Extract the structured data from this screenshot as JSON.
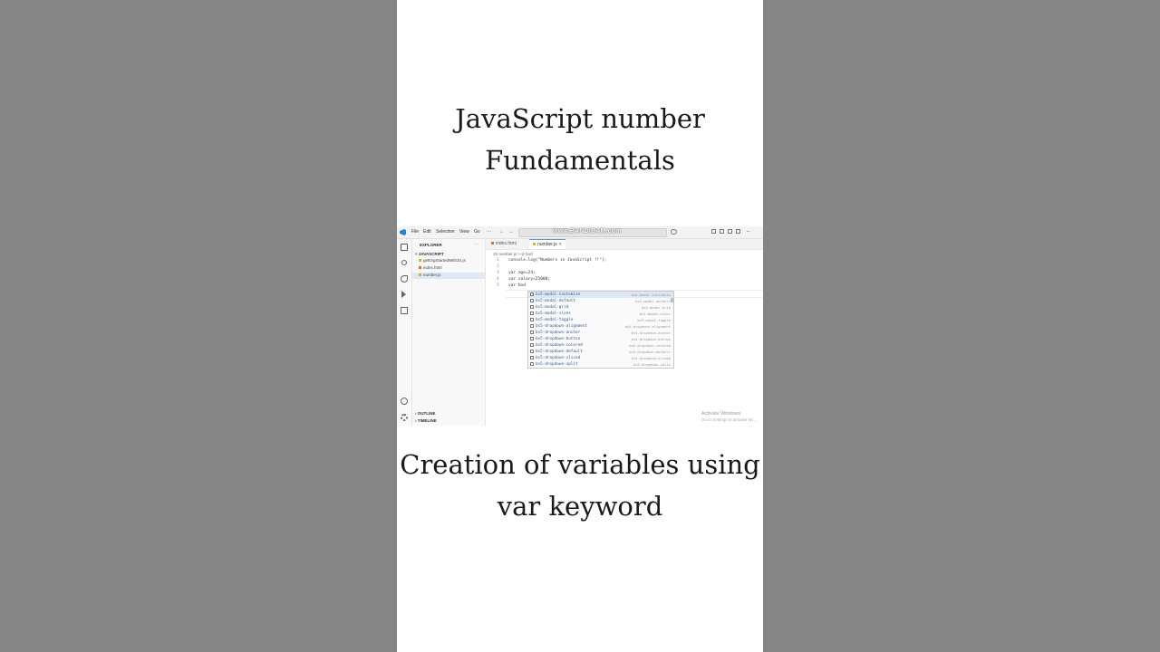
{
  "heading": {
    "line1": "JavaScript number",
    "line2": "Fundamentals"
  },
  "caption": {
    "line1": "Creation of variables using",
    "line2": "var keyword"
  },
  "menubar": {
    "items": [
      "File",
      "Edit",
      "Selection",
      "View",
      "Go",
      "···"
    ],
    "back_arrow": "←",
    "forward_arrow": "→",
    "watermark": "www.BANDICAM.com"
  },
  "sidebar": {
    "title": "EXPLORER",
    "more": "···",
    "folder": "JAVASCRIPT",
    "files": [
      "gettingStartedWithJS.js",
      "index.html",
      "number.js"
    ],
    "outline": "OUTLINE",
    "timeline": "TIMELINE"
  },
  "tabs": [
    {
      "label": "index.html",
      "active": false
    },
    {
      "label": "number.js",
      "active": true,
      "close": "✕"
    }
  ],
  "breadcrumb": "JS number.js > ⊘ bod",
  "code": {
    "line_numbers": [
      "1",
      "2",
      "3",
      "4",
      "5"
    ],
    "lines": [
      "console.log(\"Numbers in JavaScript !!\");",
      "",
      "var age=24;",
      "var salary=25000;",
      "var bod"
    ]
  },
  "suggestions": [
    {
      "name": "bs5-modal-customize",
      "detail": "bs5-modal-customize",
      "selected": true
    },
    {
      "name": "bs5-modal-default",
      "detail": "bs5-modal-default"
    },
    {
      "name": "bs5-modal-grid",
      "detail": "bs5-modal-grid"
    },
    {
      "name": "bs5-modal-sizes",
      "detail": "bs5-modal-sizes"
    },
    {
      "name": "bs5-modal-toggle",
      "detail": "bs5-modal-toggle"
    },
    {
      "name": "bs5-dropdown-alignment",
      "detail": "bs5-dropdown-alignment"
    },
    {
      "name": "bs5-dropdown-anchor",
      "detail": "bs5-dropdown-anchor"
    },
    {
      "name": "bs5-dropdown-button",
      "detail": "bs5-dropdown-button"
    },
    {
      "name": "bs5-dropdown-colored",
      "detail": "bs5-dropdown-colored"
    },
    {
      "name": "bs5-dropdown-default",
      "detail": "bs5-dropdown-default"
    },
    {
      "name": "bs5-dropdown-sliced",
      "detail": "bs5-dropdown-sliced"
    },
    {
      "name": "bs5-dropdown-split",
      "detail": "bs5-dropdown-split"
    }
  ],
  "activate_windows": {
    "title": "Activate Windows",
    "subtitle": "Go to Settings to activate Wi..."
  },
  "colors": {
    "background": "#858585",
    "accent": "#1f87d6",
    "suggestion_text": "#2d5a9a"
  },
  "icons": [
    "files-icon",
    "search-icon",
    "source-control-icon",
    "run-debug-icon",
    "extensions-icon",
    "account-icon",
    "settings-gear-icon"
  ]
}
